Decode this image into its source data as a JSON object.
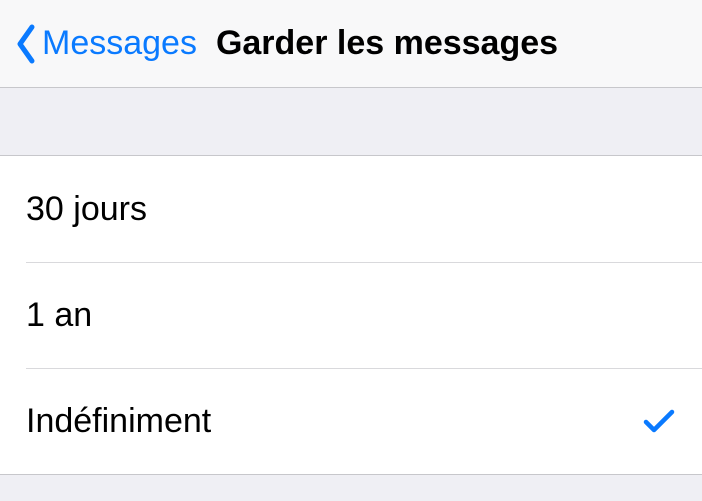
{
  "navbar": {
    "back_label": "Messages",
    "title": "Garder les messages"
  },
  "options": [
    {
      "label": "30 jours",
      "selected": false
    },
    {
      "label": "1 an",
      "selected": false
    },
    {
      "label": "Indéfiniment",
      "selected": true
    }
  ]
}
